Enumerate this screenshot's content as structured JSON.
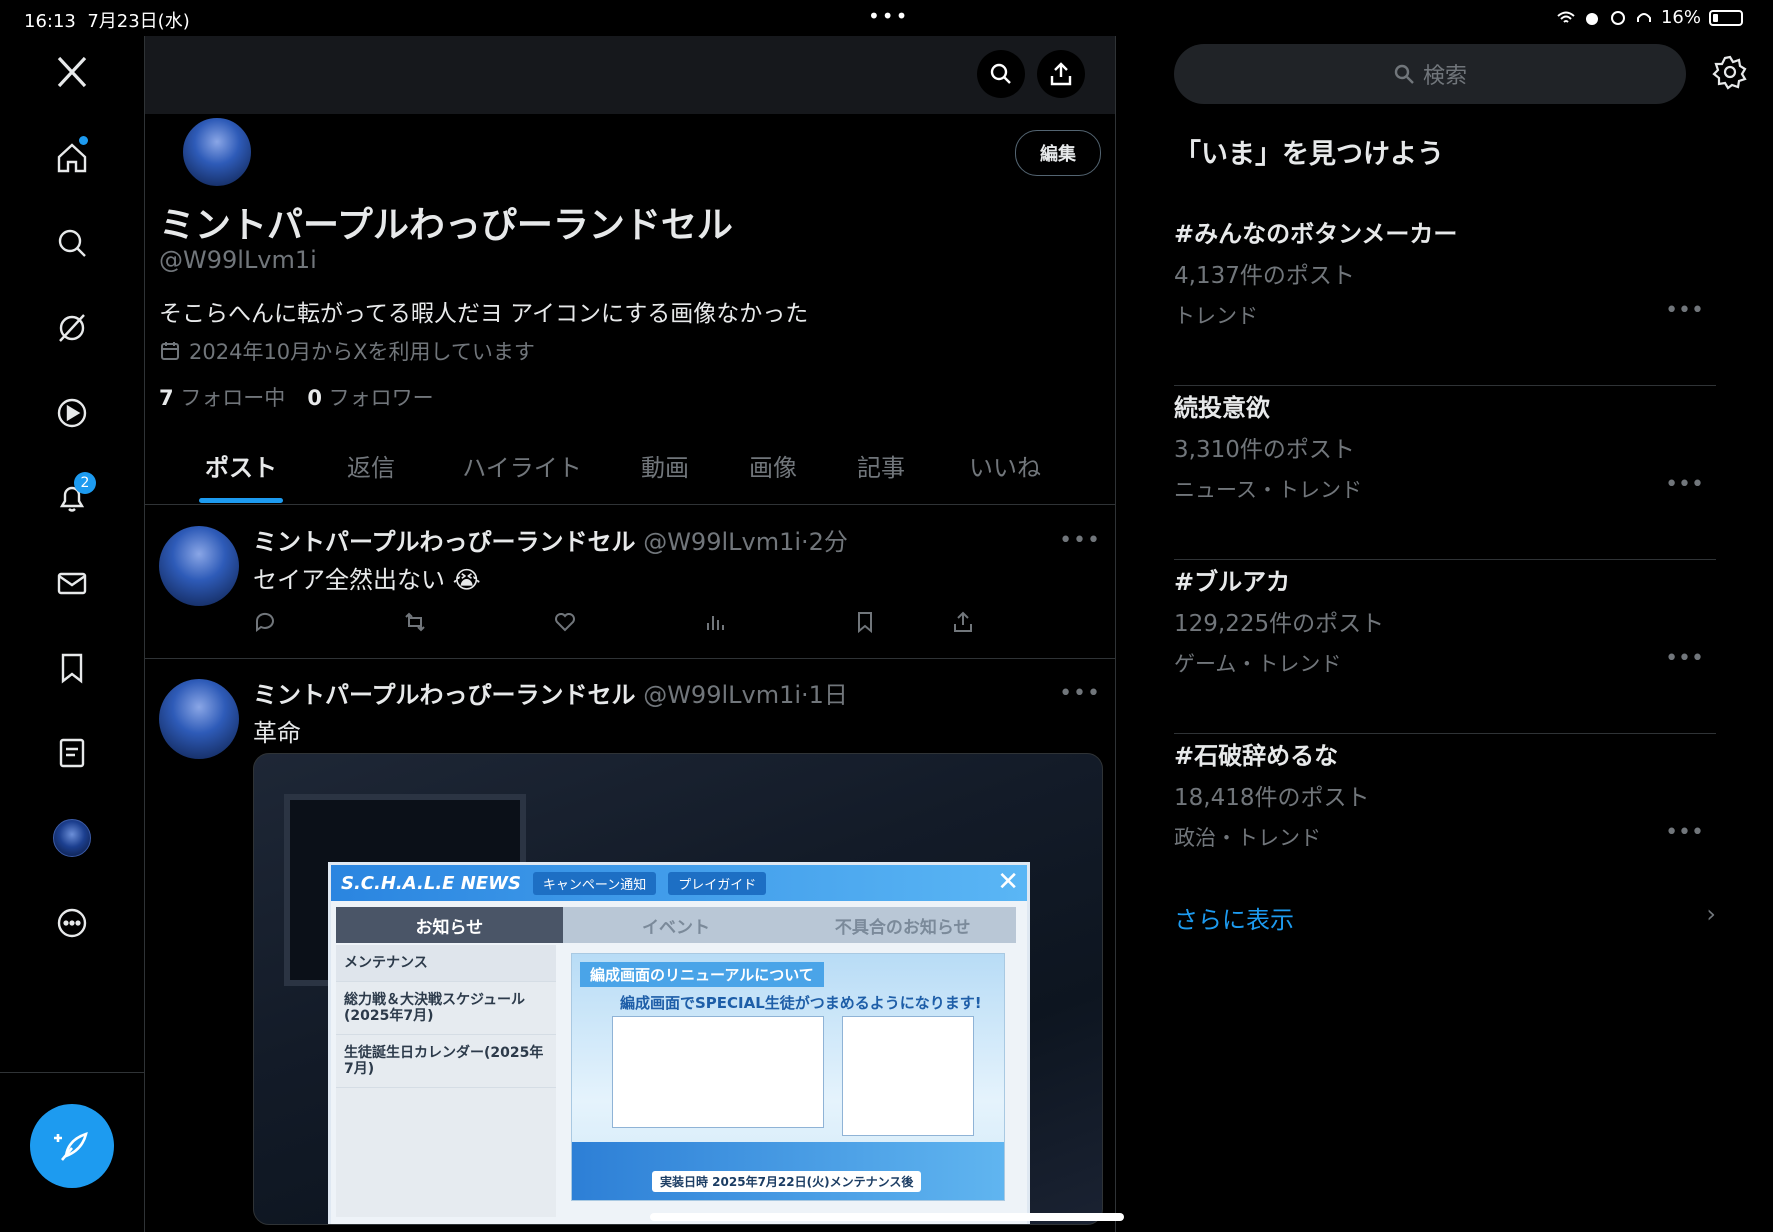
{
  "status": {
    "time": "16:13",
    "date": "7月23日(水)",
    "dots": "•••",
    "battery": "16%"
  },
  "nav": {
    "notifications_badge": "2"
  },
  "profile": {
    "name": "ミントパープルわっぴーランドセル",
    "handle": "@W99lLvm1i",
    "bio": "そこらへんに転がってる暇人だヨ アイコンにする画像なかった",
    "joined": "2024年10月からXを利用しています",
    "following_count": "7",
    "following_label": "フォロー中",
    "followers_count": "0",
    "followers_label": "フォロワー",
    "edit_label": "編集"
  },
  "tabs": [
    "ポスト",
    "返信",
    "ハイライト",
    "動画",
    "画像",
    "記事",
    "いいね"
  ],
  "posts": [
    {
      "name": "ミントパープルわっぴーランドセル",
      "handle": "@W99lLvm1i",
      "time": "·2分",
      "text": "セイア全然出ない 😭"
    },
    {
      "name": "ミントパープルわっぴーランドセル",
      "handle": "@W99lLvm1i",
      "time": "·1日",
      "text": "革命"
    }
  ],
  "media": {
    "logo": "S.C.H.A.L.E NEWS",
    "pill1": "キャンペーン通知",
    "pill2": "プレイガイド",
    "tab1": "お知らせ",
    "tab2": "イベント",
    "tab3": "不具合のお知らせ",
    "list": [
      "メンテナンス",
      "総力戦＆大決戦スケジュール(2025年7月)",
      "生徒誕生日カレンダー(2025年7月)"
    ],
    "banner_title": "編成画面のリニューアルについて",
    "banner_sub": "編成画面でSPECIAL生徒がつまめるようになります!",
    "banner_date": "実装日時 2025年7月22日(火)メンテナンス後"
  },
  "right": {
    "search_placeholder": "検索",
    "title": "「いま」を見つけよう",
    "trends": [
      {
        "name": "#みんなのボタンメーカー",
        "count": "4,137件のポスト",
        "category": "トレンド"
      },
      {
        "name": "続投意欲",
        "count": "3,310件のポスト",
        "category": "ニュース・トレンド"
      },
      {
        "name": "#ブルアカ",
        "count": "129,225件のポスト",
        "category": "ゲーム・トレンド"
      },
      {
        "name": "#石破辞めるな",
        "count": "18,418件のポスト",
        "category": "政治・トレンド"
      }
    ],
    "show_more": "さらに表示"
  },
  "colors": {
    "accent": "#1d9bf0",
    "background": "#000000",
    "text": "#e7e9ea",
    "muted": "#71767b",
    "border": "#2f3336"
  }
}
